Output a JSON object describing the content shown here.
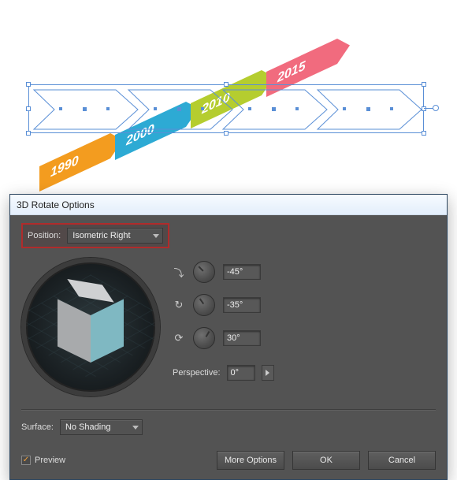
{
  "timeline": {
    "arrows": [
      {
        "label": "1990",
        "color": "#f39c1f"
      },
      {
        "label": "2000",
        "color": "#2daad4"
      },
      {
        "label": "2010",
        "color": "#b5cd2f"
      },
      {
        "label": "2015",
        "color": "#f16b7e"
      }
    ]
  },
  "dialog": {
    "title": "3D Rotate Options",
    "position_label": "Position:",
    "position_value": "Isometric Right",
    "angles": {
      "x": "-45°",
      "y": "-35°",
      "z": "30°"
    },
    "perspective_label": "Perspective:",
    "perspective_value": "0°",
    "surface_label": "Surface:",
    "surface_value": "No Shading",
    "preview_label": "Preview",
    "preview_checked": true,
    "buttons": {
      "more": "More Options",
      "ok": "OK",
      "cancel": "Cancel"
    }
  }
}
